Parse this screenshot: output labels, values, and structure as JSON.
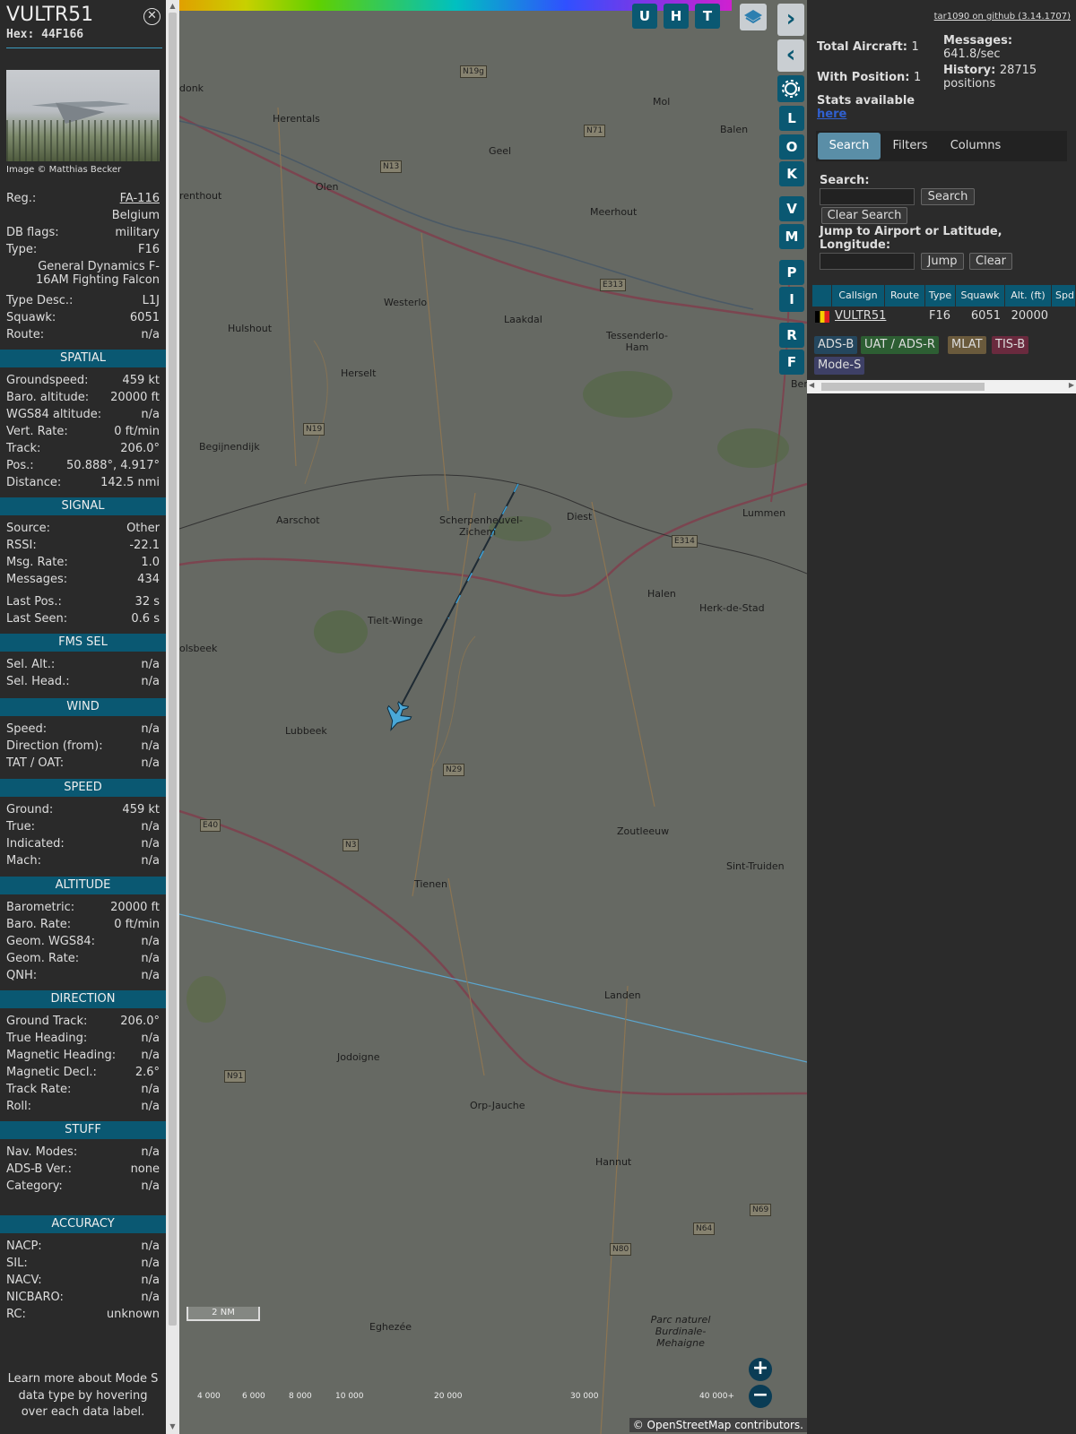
{
  "sidebar": {
    "callsign": "VULTR51",
    "hex_label": "Hex:",
    "hex": "44F166",
    "photo_credit": "Image © Matthias Becker",
    "info_rows": [
      {
        "k": "Reg.:",
        "v": "FA-116"
      },
      {
        "k": "",
        "v": "Belgium"
      },
      {
        "k": "DB flags:",
        "v": "military"
      },
      {
        "k": "Type:",
        "v": "F16"
      },
      {
        "k": "",
        "v": "General Dynamics F-16AM Fighting Falcon"
      },
      {
        "k": "Type Desc.:",
        "v": "L1J"
      },
      {
        "k": "Squawk:",
        "v": "6051"
      },
      {
        "k": "Route:",
        "v": "n/a"
      }
    ],
    "sections": [
      {
        "title": "SPATIAL",
        "rows": [
          {
            "k": "Groundspeed:",
            "v": "459 kt"
          },
          {
            "k": "Baro. altitude:",
            "v": "20000 ft"
          },
          {
            "k": "WGS84 altitude:",
            "v": "n/a"
          },
          {
            "k": "Vert. Rate:",
            "v": "0 ft/min"
          },
          {
            "k": "Track:",
            "v": "206.0°"
          },
          {
            "k": "Pos.:",
            "v": "50.888°, 4.917°"
          },
          {
            "k": "Distance:",
            "v": "142.5 nmi"
          }
        ]
      },
      {
        "title": "SIGNAL",
        "rows": [
          {
            "k": "Source:",
            "v": "Other"
          },
          {
            "k": "RSSI:",
            "v": "-22.1"
          },
          {
            "k": "Msg. Rate:",
            "v": "1.0"
          },
          {
            "k": "Messages:",
            "v": "434"
          },
          {
            "k": "Last Pos.:",
            "v": "32 s"
          },
          {
            "k": "Last Seen:",
            "v": "0.6 s"
          }
        ]
      },
      {
        "title": "FMS SEL",
        "rows": [
          {
            "k": "Sel. Alt.:",
            "v": "n/a"
          },
          {
            "k": "Sel. Head.:",
            "v": "n/a"
          }
        ]
      },
      {
        "title": "WIND",
        "rows": [
          {
            "k": "Speed:",
            "v": "n/a"
          },
          {
            "k": "Direction (from):",
            "v": "n/a"
          },
          {
            "k": "TAT / OAT:",
            "v": "n/a"
          }
        ]
      },
      {
        "title": "SPEED",
        "rows": [
          {
            "k": "Ground:",
            "v": "459 kt"
          },
          {
            "k": "True:",
            "v": "n/a"
          },
          {
            "k": "Indicated:",
            "v": "n/a"
          },
          {
            "k": "Mach:",
            "v": "n/a"
          }
        ]
      },
      {
        "title": "ALTITUDE",
        "rows": [
          {
            "k": "Barometric:",
            "v": "20000 ft"
          },
          {
            "k": "Baro. Rate:",
            "v": "0 ft/min"
          },
          {
            "k": "Geom. WGS84:",
            "v": "n/a"
          },
          {
            "k": "Geom. Rate:",
            "v": "n/a"
          },
          {
            "k": "QNH:",
            "v": "n/a"
          }
        ]
      },
      {
        "title": "DIRECTION",
        "rows": [
          {
            "k": "Ground Track:",
            "v": "206.0°"
          },
          {
            "k": "True Heading:",
            "v": "n/a"
          },
          {
            "k": "Magnetic Heading:",
            "v": "n/a"
          },
          {
            "k": "Magnetic Decl.:",
            "v": "2.6°"
          },
          {
            "k": "Track Rate:",
            "v": "n/a"
          },
          {
            "k": "Roll:",
            "v": "n/a"
          }
        ]
      },
      {
        "title": "STUFF",
        "rows": [
          {
            "k": "Nav. Modes:",
            "v": "n/a"
          },
          {
            "k": "ADS-B Ver.:",
            "v": "none"
          },
          {
            "k": "Category:",
            "v": "n/a"
          }
        ]
      },
      {
        "title": "ACCURACY",
        "rows": [
          {
            "k": "NACP:",
            "v": "n/a"
          },
          {
            "k": "SIL:",
            "v": "n/a"
          },
          {
            "k": "NACV:",
            "v": "n/a"
          },
          {
            "k": "NICBARO:",
            "v": "n/a"
          },
          {
            "k": "RC:",
            "v": "unknown"
          }
        ]
      }
    ],
    "footer_note": "Learn more about Mode S data type by hovering over each data label."
  },
  "map": {
    "buttons_top": [
      "U",
      "H",
      "T"
    ],
    "buttons_side": [
      "L",
      "O",
      "K",
      "V",
      "M",
      "P",
      "I",
      "R",
      "F"
    ],
    "places": [
      "donk",
      "Herentals",
      "Geel",
      "Mol",
      "Balen",
      "Olen",
      "Meerhout",
      "renthout",
      "Westerlo",
      "Laakdal",
      "Tessenderlo-Ham",
      "Hulshout",
      "Herselt",
      "Begijnendijk",
      "Aarschot",
      "Scherpenheuvel-Zichem",
      "Diest",
      "Lummen",
      "Tielt-Winge",
      "Halen",
      "Herk-de-Stad",
      "olsbeek",
      "Lubbeek",
      "Zoutleeuw",
      "Tienen",
      "Sint-Truiden",
      "Landen",
      "Jodoigne",
      "Orp-Jauche",
      "Hannut",
      "Eghezée",
      "Parc naturel Burdinale-Mehaigne",
      "Berin"
    ],
    "roads": [
      "N19g",
      "N71",
      "N13",
      "E313",
      "N19",
      "E314",
      "N29",
      "E40",
      "N3",
      "N91",
      "N64",
      "N69",
      "N80"
    ],
    "colorbar_labels": [
      "4 000",
      "6 000",
      "8 000",
      "10 000",
      "20 000",
      "30 000",
      "40 000+"
    ],
    "scale": "2 NM",
    "attribution_prefix": "© ",
    "attribution_link": "OpenStreetMap",
    "attribution_suffix": " contributors."
  },
  "panel": {
    "github": "tar1090 on github (3.14.1707)",
    "total_label": "Total Aircraft:",
    "total": "1",
    "messages_label": "Messages:",
    "messages": "641.8/sec",
    "position_label": "With Position:",
    "position": "1",
    "history_label": "History:",
    "history": "28715 positions",
    "stats_label": "Stats available",
    "stats_link": "here",
    "tabs": [
      "Search",
      "Filters",
      "Columns"
    ],
    "search_label": "Search:",
    "search_btn": "Search",
    "clear_search_btn": "Clear Search",
    "jump_label": "Jump to Airport or Latitude, Longitude:",
    "jump_btn": "Jump",
    "clear_btn": "Clear",
    "table_headers": [
      "Callsign",
      "Route",
      "Type",
      "Squawk",
      "Alt. (ft)",
      "Spd"
    ],
    "table_row": {
      "callsign": "VULTR51",
      "route": "",
      "type": "F16",
      "squawk": "6051",
      "alt": "20000"
    },
    "badges": [
      "ADS-B",
      "UAT / ADS-R",
      "MLAT",
      "TIS-B",
      "Mode-S"
    ]
  },
  "colors": {
    "accent": "#0a5872",
    "track": "#3a9fd6",
    "aircraft": "#4aa8d8"
  }
}
